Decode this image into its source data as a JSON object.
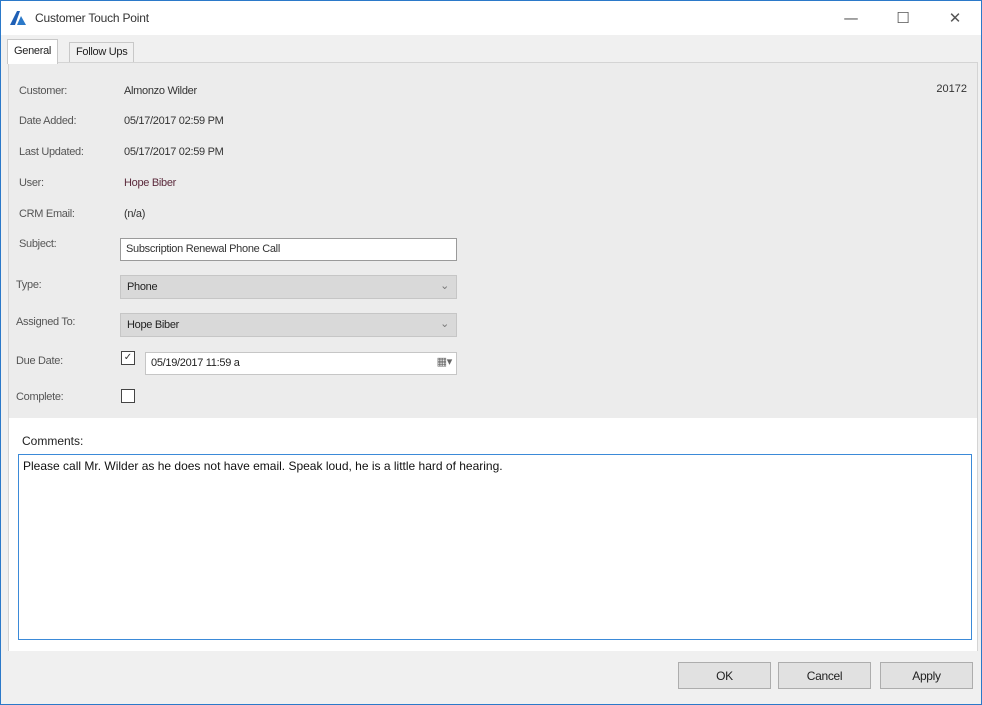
{
  "window": {
    "title": "Customer Touch Point",
    "minimize_glyph": "—",
    "maximize_glyph": "☐",
    "close_glyph": "✕"
  },
  "tabs": [
    {
      "label": "General",
      "active": true
    },
    {
      "label": "Follow Ups",
      "active": false
    }
  ],
  "general": {
    "customer_label": "Customer:",
    "customer_value": "Almonzo Wilder",
    "customer_id": "20172",
    "date_added_label": "Date Added:",
    "date_added_value": "05/17/2017 02:59 PM",
    "last_updated_label": "Last Updated:",
    "last_updated_value": "05/17/2017 02:59 PM",
    "user_label": "User:",
    "user_value": "Hope Biber",
    "crm_email_label": "CRM Email:",
    "crm_email_value": "(n/a)",
    "subject_label": "Subject:",
    "subject_value": "Subscription Renewal Phone Call",
    "type_label": "Type:",
    "type_value": "Phone",
    "assigned_to_label": "Assigned To:",
    "assigned_to_value": "Hope Biber",
    "due_date_label": "Due Date:",
    "due_date_checked": true,
    "due_date_value": "05/19/2017 11:59 a",
    "complete_label": "Complete:",
    "complete_checked": false
  },
  "comments": {
    "label": "Comments:",
    "text": "Please call Mr. Wilder as he does not have email.  Speak loud, he is a little hard of hearing."
  },
  "buttons": {
    "ok": "OK",
    "cancel": "Cancel",
    "apply": "Apply"
  },
  "colors": {
    "accent": "#2b79c9",
    "focus_border": "#3b8ad8"
  }
}
